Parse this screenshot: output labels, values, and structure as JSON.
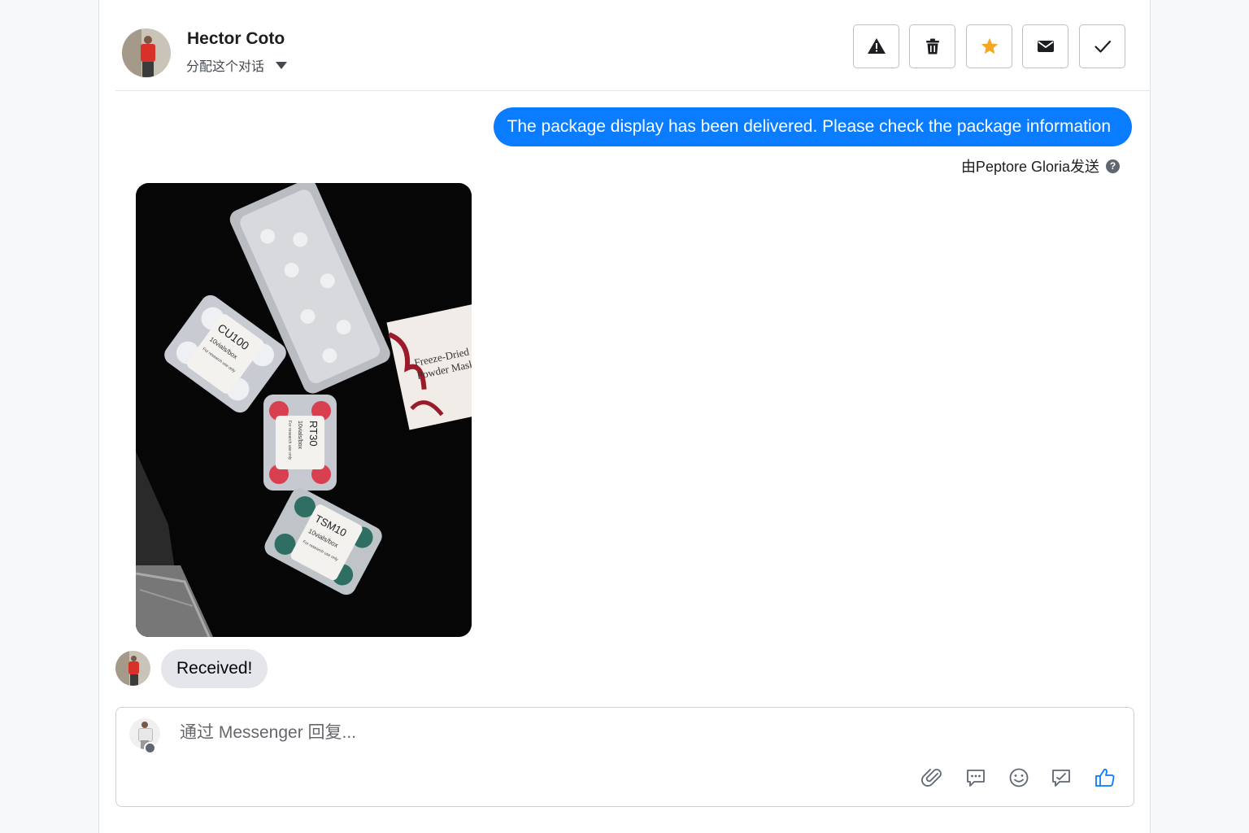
{
  "header": {
    "contact_name": "Hector Coto",
    "assign_label": "分配这个对话",
    "toolbar": [
      {
        "name": "spam",
        "icon": "warning-icon"
      },
      {
        "name": "delete",
        "icon": "trash-icon"
      },
      {
        "name": "star",
        "icon": "star-icon",
        "color": "#f5a623"
      },
      {
        "name": "mark-unread",
        "icon": "envelope-icon"
      },
      {
        "name": "mark-done",
        "icon": "checkmark-icon"
      }
    ]
  },
  "messages": {
    "outgoing_text": "The package display has been delivered. Please check the package information",
    "sent_by": "由Peptore Gloria发送",
    "help_glyph": "?",
    "photo_labels": {
      "box1_code": "CU100",
      "box1_qty": "10vials/box",
      "box1_note": "For research use only",
      "box2_code": "RT30",
      "box2_qty": "10vials/box",
      "box2_note": "For research use only",
      "box3_code": "TSM10",
      "box3_qty": "10vials/box",
      "box3_note": "For research use only",
      "mask_line1": "Freeze-Dried",
      "mask_line2": "Powder Mask"
    },
    "incoming_text": "Received!"
  },
  "composer": {
    "placeholder": "通过 Messenger 回复...",
    "icons": [
      "paperclip-icon",
      "saved-reply-icon",
      "emoji-icon",
      "appointment-icon",
      "like-icon"
    ]
  },
  "colors": {
    "accent": "#0a7cff",
    "star": "#f5a623",
    "incoming_bubble": "#e4e6eb"
  }
}
